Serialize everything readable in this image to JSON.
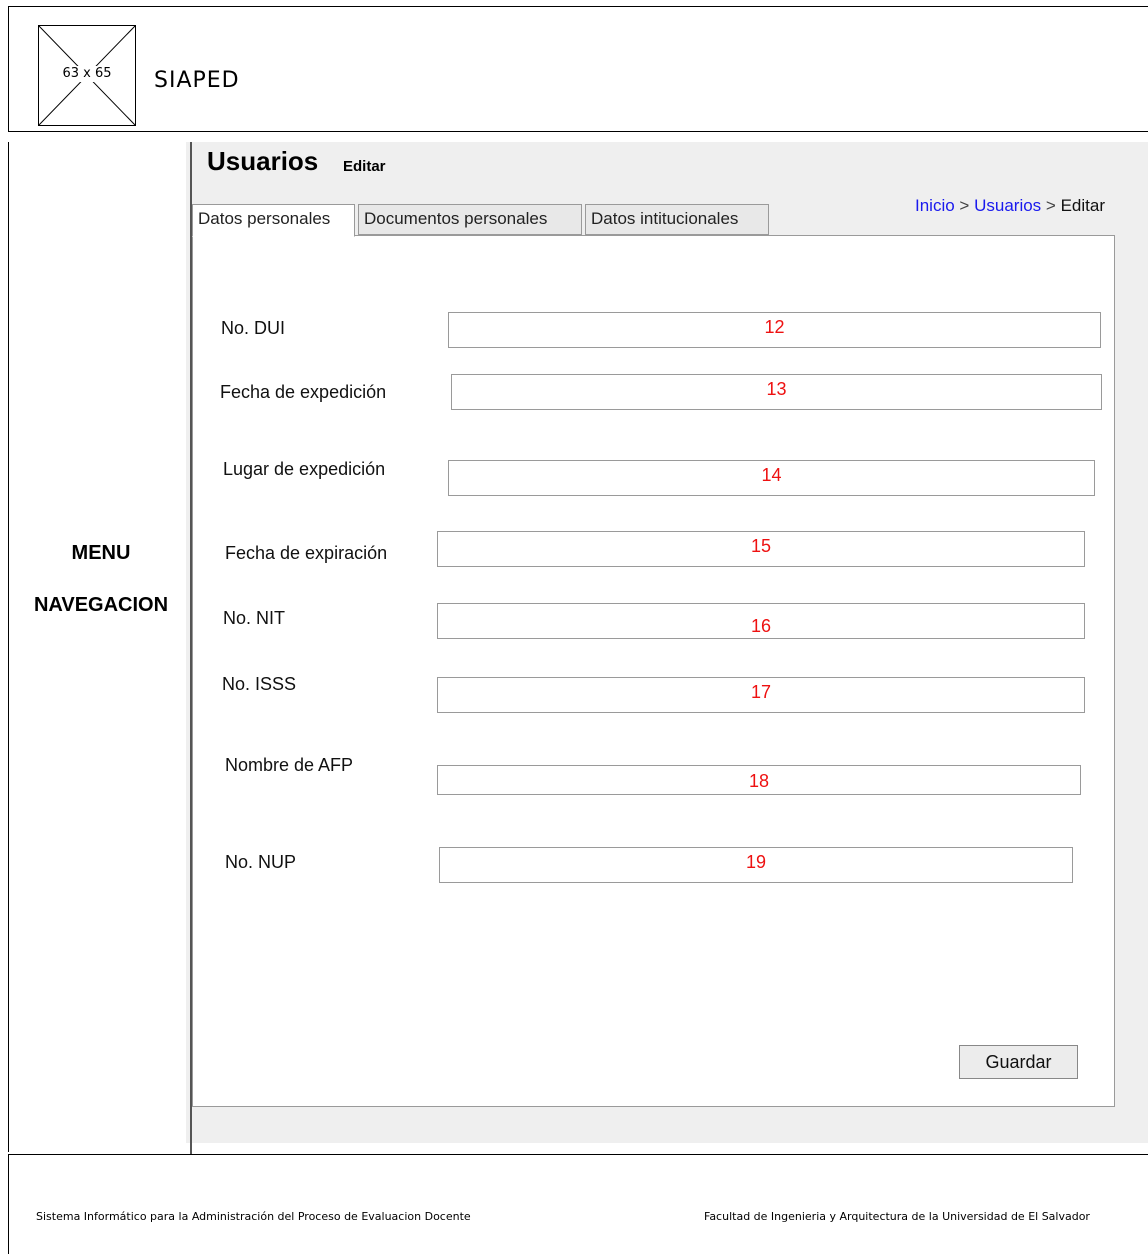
{
  "header": {
    "logo_placeholder": "63 x 65",
    "app_title": "SIAPED"
  },
  "menu": {
    "label_line1": "MENU",
    "label_line2": "NAVEGACION"
  },
  "page": {
    "title": "Usuarios",
    "subtitle": "Editar"
  },
  "breadcrumb": {
    "items": [
      "Inicio",
      "Usuarios",
      "Editar"
    ],
    "separator": ">"
  },
  "tabs": [
    {
      "label": "Datos personales",
      "active": true
    },
    {
      "label": "Documentos personales",
      "active": false
    },
    {
      "label": "Datos intitucionales",
      "active": false
    }
  ],
  "form": {
    "fields": [
      {
        "label": "No. DUI",
        "value": "12"
      },
      {
        "label": "Fecha de expedición",
        "value": "13"
      },
      {
        "label": "Lugar de expedición",
        "value": "14"
      },
      {
        "label": "Fecha de expiración",
        "value": "15"
      },
      {
        "label": "No. NIT",
        "value": "16"
      },
      {
        "label": "No. ISSS",
        "value": "17"
      },
      {
        "label": "Nombre de AFP",
        "value": "18"
      },
      {
        "label": "No. NUP",
        "value": "19"
      }
    ],
    "save_label": "Guardar"
  },
  "footer": {
    "left_text": "Sistema Informático para la Administración del Proceso de Evaluacion Docente",
    "right_text": "Facultad de Ingenieria y Arquitectura de la Universidad de El Salvador"
  },
  "colors": {
    "field_value": "#ee1111",
    "breadcrumb_link": "#1a1aee",
    "content_background": "#efefef"
  }
}
